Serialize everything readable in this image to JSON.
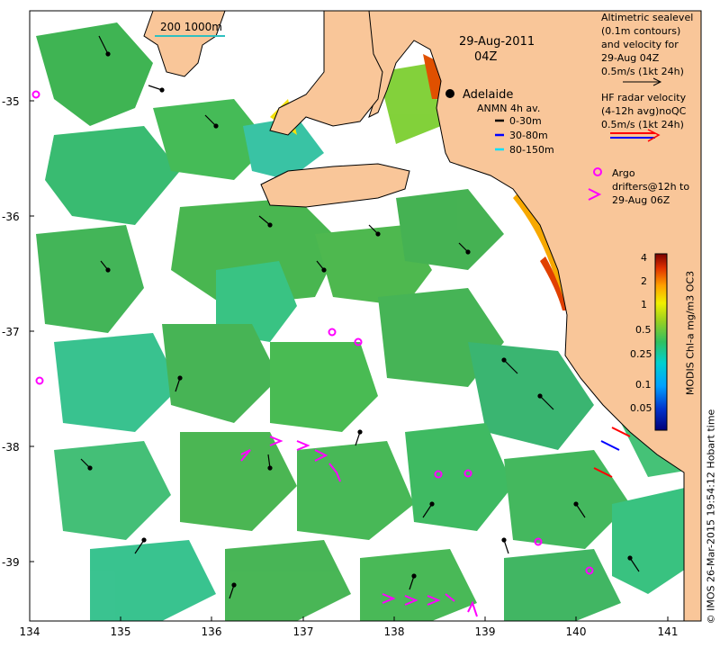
{
  "date": "29-Aug-2011",
  "time": "04Z",
  "scale_bar_label": "200  1000m",
  "place": "Adelaide",
  "anmn": {
    "title": "ANMN 4h av.",
    "items": [
      {
        "label": "0-30m",
        "color": "#000000"
      },
      {
        "label": "30-80m",
        "color": "#0000ff"
      },
      {
        "label": "80-150m",
        "color": "#00e0ff"
      }
    ]
  },
  "altimetry": {
    "lines": [
      "Altimetric sealevel",
      "(0.1m contours)",
      "and velocity for",
      "29-Aug 04Z",
      "0.5m/s (1kt 24h)"
    ]
  },
  "hf_radar": {
    "lines": [
      "HF radar velocity",
      "(4-12h avg)noQC",
      "0.5m/s (1kt 24h)"
    ]
  },
  "argo": {
    "label": "Argo"
  },
  "drifters": {
    "label": "drifters@12h to",
    "label2": "29-Aug 06Z"
  },
  "colorbar": {
    "title": "MODIS Chl-a mg/m3 OC3",
    "ticks": [
      "4",
      "2",
      "1",
      "0.5",
      "0.25",
      "0.1",
      "0.05"
    ]
  },
  "credit": "© IMOS 26-Mar-2015 19:54:12 Hobart time",
  "x_ticks": [
    "134",
    "135",
    "136",
    "137",
    "138",
    "139",
    "140",
    "141"
  ],
  "y_ticks": [
    "-35",
    "-36",
    "-37",
    "-38",
    "-39"
  ],
  "colors": {
    "land": "#f9c699",
    "ocean": "#ffffff",
    "chl_green": "#3fb34a",
    "chl_teal": "#2fc0a0",
    "argo": "#ff00ff"
  }
}
